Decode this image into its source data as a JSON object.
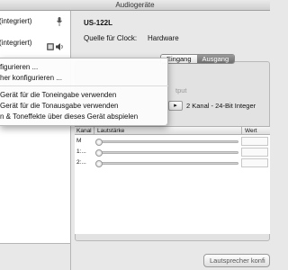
{
  "window": {
    "title": "Audiogeräte"
  },
  "sidebar": {
    "devices": [
      {
        "label": "(integriert)",
        "icon": "microphone-icon"
      },
      {
        "label": "(integriert)",
        "icon": "speaker-icon"
      }
    ]
  },
  "context_menu": {
    "items": [
      "figurieren ...",
      "her konfigurieren ...",
      "Gerät für die Toneingabe verwenden",
      "Gerät für die Tonausgabe verwenden",
      "n & Toneffekte über dieses Gerät abspielen"
    ]
  },
  "device": {
    "name": "US-122L",
    "clock_label": "Quelle für Clock:",
    "clock_value": "Hardware"
  },
  "tabs": [
    {
      "label": "Eingang",
      "active": false
    },
    {
      "label": "Ausgang",
      "active": true
    }
  ],
  "format": {
    "label": "tput",
    "select_glyph": "▸",
    "value": "2 Kanal - 24-Bit Integer"
  },
  "volume_table": {
    "headers": {
      "channel": "Kanal",
      "volume": "Lautstärke",
      "value": "Wert"
    },
    "rows": [
      {
        "channel": "M"
      },
      {
        "channel": "1:..."
      },
      {
        "channel": "2:..."
      }
    ]
  },
  "buttons": {
    "speaker_config": "Lautsprecher konfi"
  }
}
